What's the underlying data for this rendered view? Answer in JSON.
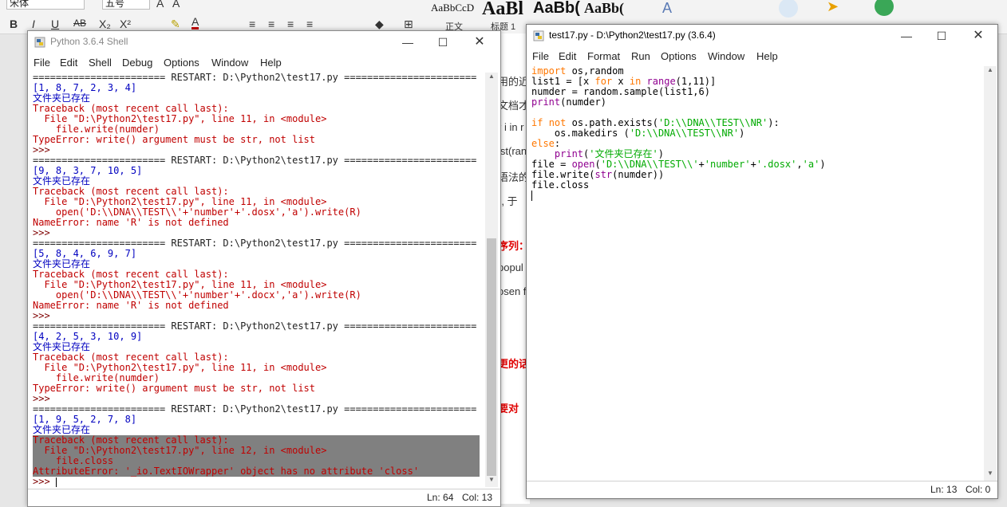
{
  "word": {
    "font_name": "宋体",
    "font_size": "五号",
    "styles": [
      {
        "sample": "AaBbCcD",
        "name": "正文"
      },
      {
        "sample": "AaBl",
        "name": "标题 1"
      },
      {
        "sample": "AaBb(",
        "name": ""
      },
      {
        "sample": "AaBb(",
        "name": ""
      }
    ],
    "doc_fragments": [
      "用的近",
      "文档才",
      "r i in r",
      "ist(ran",
      "语法的",
      "), 于",
      "序列：",
      "popul",
      "osen f",
      "更的话",
      "要对"
    ]
  },
  "shell": {
    "title": "Python 3.6.4 Shell",
    "menu": [
      "File",
      "Edit",
      "Shell",
      "Debug",
      "Options",
      "Window",
      "Help"
    ],
    "lines": [
      {
        "t": "======================= RESTART: D:\\Python2\\test17.py =======================",
        "c": "sep"
      },
      {
        "t": "[1, 8, 7, 2, 3, 4]",
        "c": "out"
      },
      {
        "t": "文件夹已存在",
        "c": "out"
      },
      {
        "t": "Traceback (most recent call last):",
        "c": "err"
      },
      {
        "t": "  File \"D:\\Python2\\test17.py\", line 11, in <module>",
        "c": "err"
      },
      {
        "t": "    file.write(numder)",
        "c": "err"
      },
      {
        "t": "TypeError: write() argument must be str, not list",
        "c": "err"
      },
      {
        "t": ">>> ",
        "c": "prompt"
      },
      {
        "t": "======================= RESTART: D:\\Python2\\test17.py =======================",
        "c": "sep"
      },
      {
        "t": "[9, 8, 3, 7, 10, 5]",
        "c": "out"
      },
      {
        "t": "文件夹已存在",
        "c": "out"
      },
      {
        "t": "Traceback (most recent call last):",
        "c": "err"
      },
      {
        "t": "  File \"D:\\Python2\\test17.py\", line 11, in <module>",
        "c": "err"
      },
      {
        "t": "    open('D:\\\\DNA\\\\TEST\\\\'+'number'+'.dosx','a').write(R)",
        "c": "err"
      },
      {
        "t": "NameError: name 'R' is not defined",
        "c": "err"
      },
      {
        "t": ">>> ",
        "c": "prompt"
      },
      {
        "t": "======================= RESTART: D:\\Python2\\test17.py =======================",
        "c": "sep"
      },
      {
        "t": "[5, 8, 4, 6, 9, 7]",
        "c": "out"
      },
      {
        "t": "文件夹已存在",
        "c": "out"
      },
      {
        "t": "Traceback (most recent call last):",
        "c": "err"
      },
      {
        "t": "  File \"D:\\Python2\\test17.py\", line 11, in <module>",
        "c": "err"
      },
      {
        "t": "    open('D:\\\\DNA\\\\TEST\\\\'+'number'+'.docx','a').write(R)",
        "c": "err"
      },
      {
        "t": "NameError: name 'R' is not defined",
        "c": "err"
      },
      {
        "t": ">>> ",
        "c": "prompt"
      },
      {
        "t": "======================= RESTART: D:\\Python2\\test17.py =======================",
        "c": "sep"
      },
      {
        "t": "[4, 2, 5, 3, 10, 9]",
        "c": "out"
      },
      {
        "t": "文件夹已存在",
        "c": "out"
      },
      {
        "t": "Traceback (most recent call last):",
        "c": "err"
      },
      {
        "t": "  File \"D:\\Python2\\test17.py\", line 11, in <module>",
        "c": "err"
      },
      {
        "t": "    file.write(numder)",
        "c": "err"
      },
      {
        "t": "TypeError: write() argument must be str, not list",
        "c": "err"
      },
      {
        "t": ">>> ",
        "c": "prompt"
      },
      {
        "t": "======================= RESTART: D:\\Python2\\test17.py =======================",
        "c": "sep"
      },
      {
        "t": "[1, 9, 5, 2, 7, 8]",
        "c": "out"
      },
      {
        "t": "文件夹已存在",
        "c": "out"
      },
      {
        "t": "Traceback (most recent call last):",
        "c": "err",
        "hl": true
      },
      {
        "t": "  File \"D:\\Python2\\test17.py\", line 12, in <module>",
        "c": "err",
        "hl": true
      },
      {
        "t": "    file.closs",
        "c": "err",
        "hl": true
      },
      {
        "t": "AttributeError: '_io.TextIOWrapper' object has no attribute 'closs'",
        "c": "err",
        "hl": true
      },
      {
        "t": ">>> ",
        "c": "prompt"
      }
    ],
    "status": {
      "ln": "Ln: 64",
      "col": "Col: 13"
    }
  },
  "editor": {
    "title": "test17.py - D:\\Python2\\test17.py (3.6.4)",
    "menu": [
      "File",
      "Edit",
      "Format",
      "Run",
      "Options",
      "Window",
      "Help"
    ],
    "code": [
      [
        [
          "kw",
          "import"
        ],
        [
          "def",
          " os,random"
        ]
      ],
      [
        [
          "def",
          "list1 = [x "
        ],
        [
          "kw",
          "for"
        ],
        [
          "def",
          " x "
        ],
        [
          "kw",
          "in"
        ],
        [
          "def",
          " "
        ],
        [
          "bi",
          "range"
        ],
        [
          "def",
          "(1,11)]"
        ]
      ],
      [
        [
          "def",
          "numder = random.sample(list1,6)"
        ]
      ],
      [
        [
          "bi",
          "print"
        ],
        [
          "def",
          "(numder)"
        ]
      ],
      [
        [
          "def",
          ""
        ]
      ],
      [
        [
          "kw",
          "if"
        ],
        [
          "def",
          " "
        ],
        [
          "kw",
          "not"
        ],
        [
          "def",
          " os.path.exists("
        ],
        [
          "str",
          "'D:\\\\DNA\\\\TEST\\\\NR'"
        ],
        [
          "def",
          "):"
        ]
      ],
      [
        [
          "def",
          "    os.makedirs ("
        ],
        [
          "str",
          "'D:\\\\DNA\\\\TEST\\\\NR'"
        ],
        [
          "def",
          ")"
        ]
      ],
      [
        [
          "kw",
          "else"
        ],
        [
          "def",
          ":"
        ]
      ],
      [
        [
          "def",
          "    "
        ],
        [
          "bi",
          "print"
        ],
        [
          "def",
          "("
        ],
        [
          "str",
          "'文件夹已存在'"
        ],
        [
          "def",
          ")"
        ]
      ],
      [
        [
          "def",
          "file = "
        ],
        [
          "bi",
          "open"
        ],
        [
          "def",
          "("
        ],
        [
          "str",
          "'D:\\\\DNA\\\\TEST\\\\'"
        ],
        [
          "def",
          "+"
        ],
        [
          "str",
          "'number'"
        ],
        [
          "def",
          "+"
        ],
        [
          "str",
          "'.dosx'"
        ],
        [
          "def",
          ","
        ],
        [
          "str",
          "'a'"
        ],
        [
          "def",
          ")"
        ]
      ],
      [
        [
          "def",
          "file.write("
        ],
        [
          "bi",
          "str"
        ],
        [
          "def",
          "(numder))"
        ]
      ],
      [
        [
          "def",
          "file.closs"
        ]
      ],
      [
        [
          "def",
          ""
        ]
      ]
    ],
    "status": {
      "ln": "Ln: 13",
      "col": "Col: 0"
    }
  }
}
